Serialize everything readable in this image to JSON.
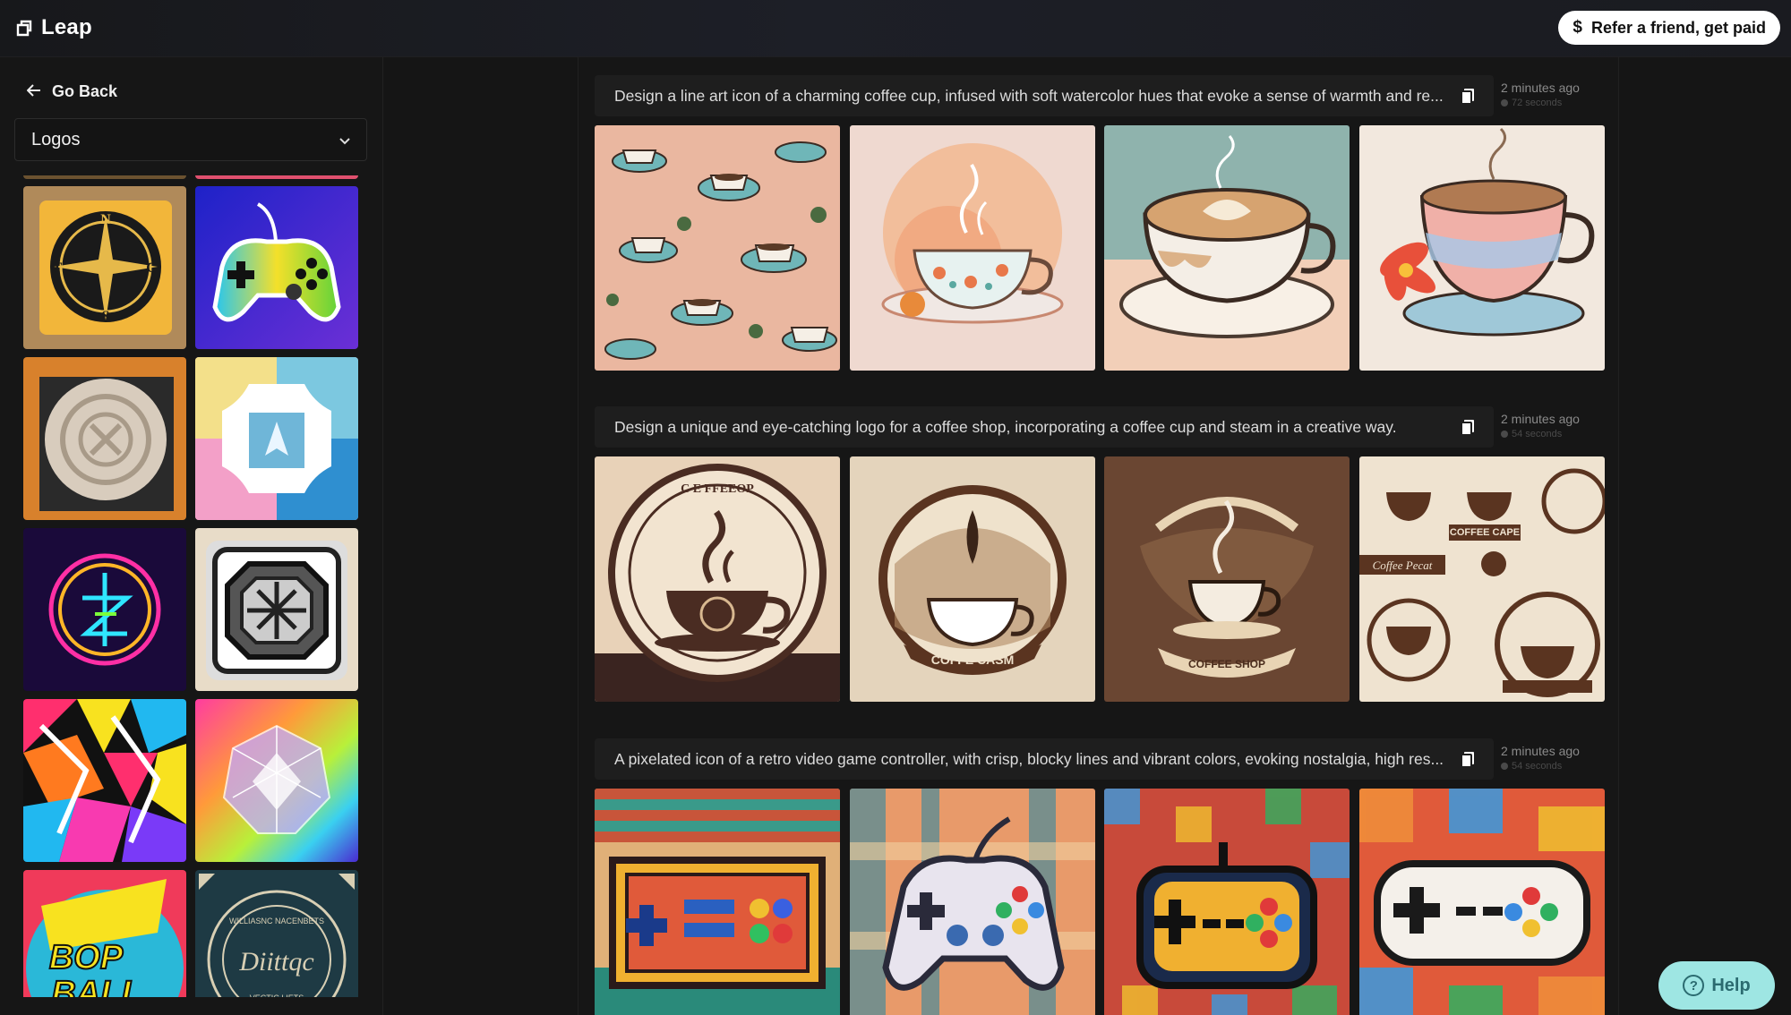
{
  "app": {
    "name": "Leap"
  },
  "header": {
    "refer_label": "Refer a friend, get paid",
    "refer_icon": "dollar-icon"
  },
  "sidebar": {
    "back_label": "Go Back",
    "category_value": "Logos",
    "thumbnails": [
      "compass-logo",
      "game-controller-logo",
      "stone-emblem-logo",
      "watercolor-arrow-logo",
      "neon-circle-logo",
      "metal-badge-logo",
      "geometric-pattern-logo",
      "prism-gem-logo",
      "bop-ball-logo",
      "vintage-badge-logo"
    ]
  },
  "feed": {
    "entries": [
      {
        "prompt": "Design a line art icon of a charming coffee cup, infused with soft watercolor hues that evoke a sense of warmth and re...",
        "time": "2 minutes ago",
        "duration": "72 seconds",
        "images": [
          "coffee-pattern",
          "watercolor-teacup",
          "latte-cup",
          "floral-cup"
        ]
      },
      {
        "prompt": "Design a unique and eye-catching logo for a coffee shop, incorporating a coffee cup and steam in a creative way.",
        "time": "2 minutes ago",
        "duration": "54 seconds",
        "images": [
          "round-coffee-badge",
          "coffee-cash-badge",
          "coffee-shop-emblem",
          "coffee-logo-sheet"
        ]
      },
      {
        "prompt": "A pixelated icon of a retro video game controller, with crisp, blocky lines and vibrant colors, evoking nostalgia, high res...",
        "time": "2 minutes ago",
        "duration": "54 seconds",
        "images": [
          "pixel-nes-controller",
          "pixel-gamepad",
          "pixel-arcade-controller",
          "pixel-white-controller"
        ]
      }
    ]
  },
  "help": {
    "label": "Help"
  },
  "colors": {
    "accent": "#9ee6e3",
    "background": "#151515",
    "panel": "#1e1e1e"
  }
}
